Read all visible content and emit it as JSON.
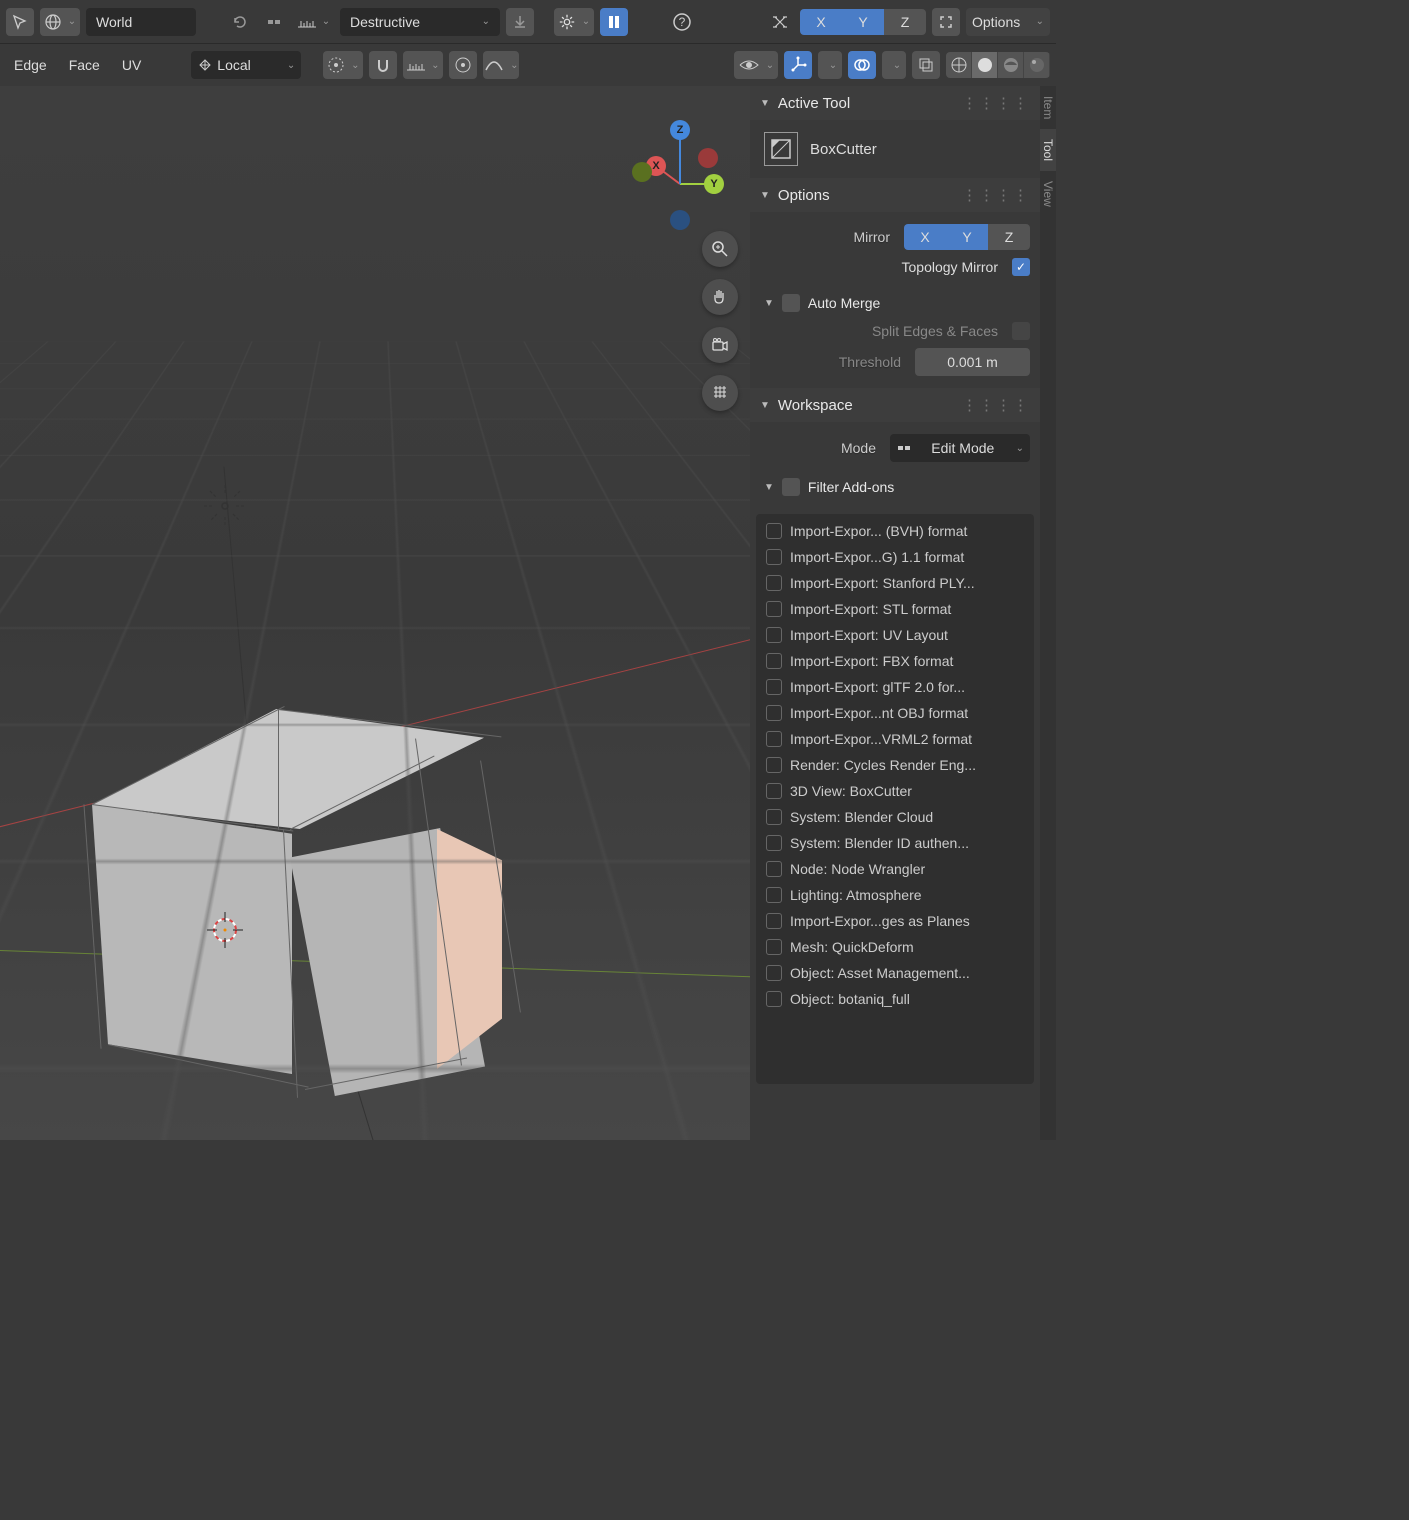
{
  "topbar": {
    "orientation": "World",
    "mode": "Destructive",
    "options_label": "Options",
    "axes": {
      "x": "X",
      "y": "Y",
      "z": "Z"
    }
  },
  "secbar": {
    "select_edge": "Edge",
    "select_face": "Face",
    "select_uv": "UV",
    "transform_orient": "Local"
  },
  "gizmo": {
    "x": "X",
    "y": "Y",
    "z": "Z"
  },
  "panels": {
    "active_tool": {
      "title": "Active Tool",
      "tool": "BoxCutter"
    },
    "options": {
      "title": "Options",
      "mirror_label": "Mirror",
      "mirror": {
        "x": "X",
        "y": "Y",
        "z": "Z"
      },
      "topo_mirror": "Topology Mirror",
      "auto_merge": "Auto Merge",
      "split_label": "Split Edges & Faces",
      "threshold_label": "Threshold",
      "threshold_value": "0.001 m"
    },
    "workspace": {
      "title": "Workspace",
      "mode_label": "Mode",
      "mode_value": "Edit Mode",
      "filter_addons": "Filter Add-ons",
      "addons": [
        "Import-Expor... (BVH) format",
        "Import-Expor...G) 1.1 format",
        "Import-Export: Stanford PLY...",
        "Import-Export: STL format",
        "Import-Export: UV Layout",
        "Import-Export: FBX format",
        "Import-Export: glTF 2.0 for...",
        "Import-Expor...nt OBJ format",
        "Import-Expor...VRML2 format",
        "Render: Cycles Render Eng...",
        "3D View: BoxCutter",
        "System: Blender Cloud",
        "System: Blender ID authen...",
        "Node: Node Wrangler",
        "Lighting: Atmosphere",
        "Import-Expor...ges as Planes",
        "Mesh: QuickDeform",
        "Object: Asset Management...",
        "Object: botaniq_full"
      ]
    }
  },
  "sidebar_tabs": [
    "Item",
    "Tool",
    "View"
  ]
}
